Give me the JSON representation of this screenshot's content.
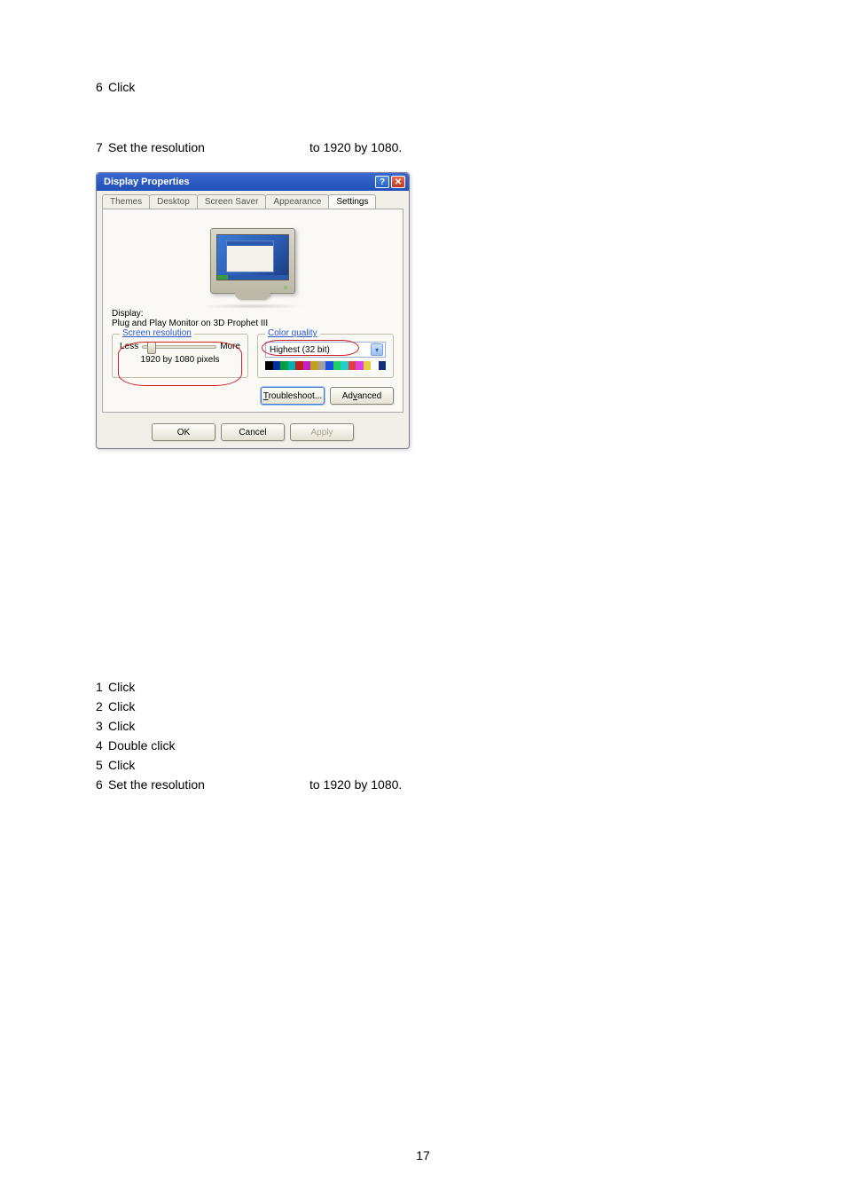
{
  "page_number": "17",
  "upper_steps": {
    "s6": "6",
    "s6_text": "Click",
    "s7": "7",
    "s7_text_a": "Set the resolution",
    "s7_text_b": "to 1920 by 1080."
  },
  "dialog": {
    "title": "Display Properties",
    "tabs": [
      "Themes",
      "Desktop",
      "Screen Saver",
      "Appearance",
      "Settings"
    ],
    "display_label": "Display:",
    "display_name": "Plug and Play Monitor on 3D Prophet III",
    "res_group": "Screen resolution",
    "res_less": "Less",
    "res_more": "More",
    "res_value": "1920 by  1080 pixels",
    "color_group": "Color quality",
    "color_value": "Highest (32 bit)",
    "troubleshoot": "Troubleshoot...",
    "troubleshoot_u": "T",
    "advanced": "Advanced",
    "advanced_u": "v",
    "ok": "OK",
    "cancel": "Cancel",
    "apply": "Apply"
  },
  "lower_steps": {
    "s1": "1",
    "s1_text": "Click",
    "s2": "2",
    "s2_text": "Click",
    "s3": "3",
    "s3_text": "Click",
    "s4": "4",
    "s4_text": "Double click",
    "s5": "5",
    "s5_text": "Click",
    "s6": "6",
    "s6_text_a": "Set the resolution",
    "s6_text_b": "to 1920 by 1080."
  }
}
